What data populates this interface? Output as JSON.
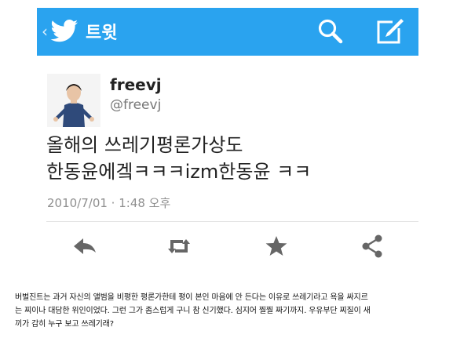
{
  "colors": {
    "action_bar": "#2aa3ef",
    "action_icon": "#666666",
    "timestamp": "#8f8f8f"
  },
  "header": {
    "back_icon": "chevron-left-icon",
    "logo_icon": "twitter-bird-icon",
    "title": "트윗",
    "search_icon": "search-icon",
    "compose_icon": "compose-icon"
  },
  "tweet": {
    "avatar": "avatar",
    "display_name": "freevj",
    "handle": "@freevj",
    "text_lines": [
      "올해의 쓰레기평론가상도",
      "한동윤에겤ㅋㅋㅋizm한동윤 ㅋㅋ"
    ],
    "timestamp": "2010/7/01 · 1:48 오후"
  },
  "actions": {
    "reply_icon": "reply-icon",
    "retweet_icon": "retweet-icon",
    "favorite_icon": "star-icon",
    "share_icon": "share-icon"
  },
  "caption": {
    "lines": [
      "버벌진트는 과거 자신의 앨범을 비평한 평론가한테 평이 본인 마음에 안 든다는 이유로 쓰레기라고 욕을 싸지르",
      "는 찌이나 대담한 위인이었다. 그런 그가 좀스럽게 구니 참 신기했다. 심지어 찔찔 짜기까지. 우유부단 찌질이 새",
      "끼가 감히 누구 보고 쓰레기래?"
    ]
  }
}
